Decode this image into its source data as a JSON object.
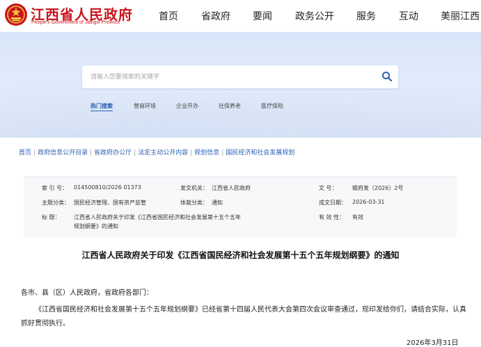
{
  "header": {
    "site_title": "江西省人民政府",
    "site_subtitle": "People's Government of Jiangxi Province",
    "nav": [
      "首页",
      "省政府",
      "要闻",
      "政务公开",
      "服务",
      "互动",
      "美丽江西"
    ]
  },
  "search": {
    "placeholder": "请输入您要搜索的关键字",
    "hot_label": "热门搜索",
    "hot_items": [
      "营商环境",
      "企业开办",
      "社保养老",
      "医疗保险"
    ]
  },
  "breadcrumb": [
    "首页",
    "政府信息公开目录",
    "省政府办公厅",
    "法定主动公开内容",
    "规划信息",
    "国民经济和社会发展规划"
  ],
  "meta": {
    "index_key": "索  引  号：",
    "index_val": "014500810/2026 01373",
    "issuer_key": "发文机关：",
    "issuer_val": "江西省人民政府",
    "docno_key": "文       号：",
    "docno_val": "赣府发〔2026〕2号",
    "topic_key": "主题分类：",
    "topic_val": "国民经济管理、国有资产监管",
    "form_key": "体裁分类：",
    "form_val": "通知",
    "date_key": "成文日期：",
    "date_val": "2026-03-31",
    "title_key": "标       题：",
    "title_val": "江西省人民政府关于印发《江西省国民经济和社会发展第十五个五年规划纲要》的通知",
    "valid_key": "有 效 性：",
    "valid_val": "有效"
  },
  "article": {
    "title": "江西省人民政府关于印发《江西省国民经济和社会发展第十五个五年规划纲要》的通知",
    "salutation": "各市、县（区）人民政府，省政府各部门：",
    "paragraph": "《江西省国民经济和社会发展第十五个五年规划纲要》已经省第十四届人民代表大会第四次会议审查通过，现印发给你们，请结合实际，认真抓好贯彻执行。",
    "sign_date": "2026年3月31日"
  },
  "colors": {
    "brand_red": "#c8161d",
    "link_blue": "#2b5fb3",
    "hero_bg": "#dde8fa"
  }
}
